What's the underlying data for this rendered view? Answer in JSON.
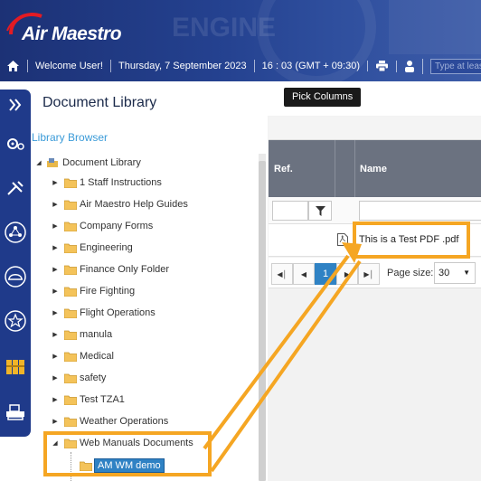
{
  "app": {
    "logo_text": "Air Maestro"
  },
  "topbar": {
    "welcome": "Welcome User!",
    "date": "Thursday, 7 September 2023",
    "time": "16 : 03  (GMT + 09:30)",
    "search_placeholder": "Type at least"
  },
  "rail": {
    "icons": [
      "chevrons-right-icon",
      "gears-icon",
      "tools-icon",
      "network-icon",
      "hardhat-icon",
      "star-icon",
      "binders-icon",
      "printer-desk-icon"
    ]
  },
  "panel": {
    "title": "Document Library",
    "browser_label": "Library Browser"
  },
  "tree": {
    "root": "Document Library",
    "items": [
      "1 Staff Instructions",
      "Air Maestro Help Guides",
      "Company Forms",
      "Engineering",
      "Finance Only Folder",
      "Fire Fighting",
      "Flight Operations",
      "manula",
      "Medical",
      "safety",
      "Test TZA1",
      "Weather Operations",
      "Web Manuals Documents"
    ],
    "selected_child": "AM WM demo"
  },
  "grid": {
    "tooltip": "Pick Columns",
    "columns": [
      "Ref.",
      "",
      "Name"
    ],
    "rows": [
      {
        "ref": "",
        "icon": "pdf-icon",
        "name": "This is a Test PDF .pdf"
      }
    ],
    "pager": {
      "current_page": "1",
      "page_size_label": "Page size:",
      "page_size": "30"
    }
  },
  "colors": {
    "header": "#24418f",
    "rail": "#1f3a8a",
    "highlight": "#f5a623",
    "accent": "#2f82c4",
    "grid_header": "#6b7280"
  }
}
